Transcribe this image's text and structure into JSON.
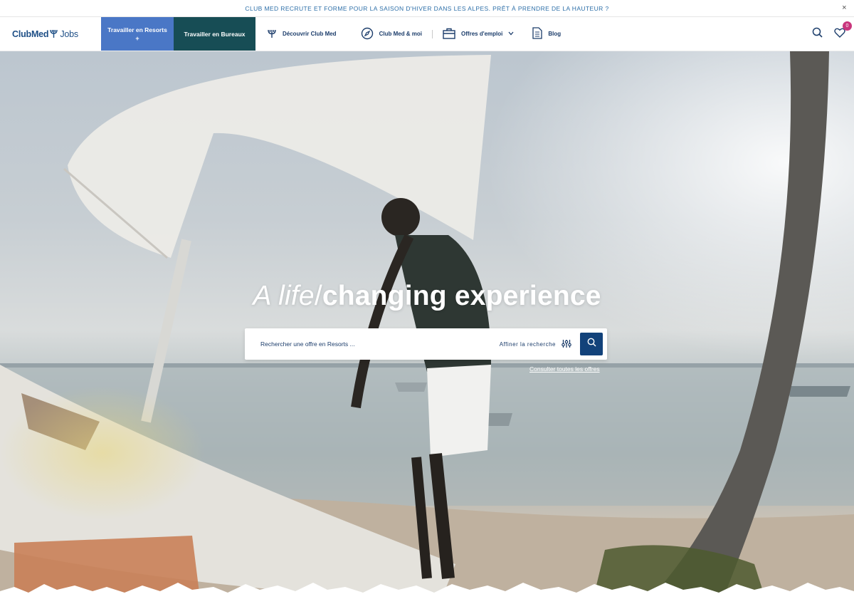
{
  "announcement": {
    "text": "CLUB MED RECRUTE ET FORME POUR LA SAISON D'HIVER DANS LES ALPES. PRÊT À PRENDRE DE LA HAUTEUR ?",
    "close_label": "×"
  },
  "header": {
    "logo_left": "ClubMed",
    "logo_right": "Jobs",
    "tabs": [
      {
        "label": "Travailler en Resorts",
        "sub": "+"
      },
      {
        "label": "Travailler en Bureaux"
      }
    ],
    "nav": [
      {
        "label": "Découvrir Club Med",
        "icon": "trident-icon"
      },
      {
        "label": "Club Med & moi",
        "icon": "compass-icon"
      },
      {
        "label": "Offres d'emploi",
        "icon": "briefcase-icon"
      },
      {
        "label": "Blog",
        "icon": "document-icon"
      }
    ],
    "favorites_count": "0"
  },
  "hero": {
    "headline_part1": "A life",
    "headline_part2": "changing experience",
    "search": {
      "placeholder": "Rechercher une offre en Resorts ...",
      "value": ""
    },
    "refine_label": "Affiner la recherche",
    "all_offers_link": "Consulter toutes les offres"
  },
  "colors": {
    "tab_resorts": "#4a77c6",
    "tab_bureaux": "#174d55",
    "brand_navy": "#1c3d6b",
    "search_button": "#12427a",
    "badge": "#c9367d",
    "announcement_text": "#2d6fa8"
  }
}
